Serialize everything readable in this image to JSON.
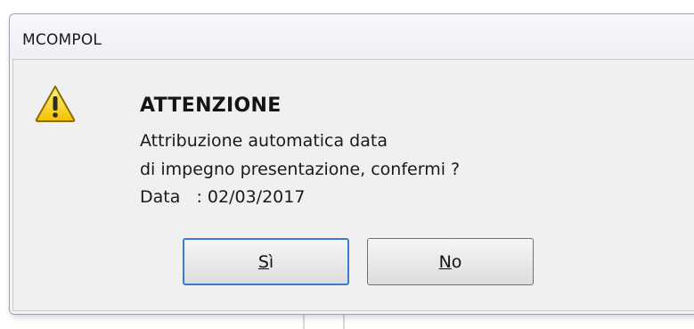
{
  "window": {
    "title": "MCOMPOL"
  },
  "icon": {
    "name": "warning-icon"
  },
  "message": {
    "heading": "ATTENZIONE",
    "line1": "Attribuzione automatica data",
    "line2": "di impegno presentazione, confermi ?",
    "line3": "Data   : 02/03/2017"
  },
  "buttons": {
    "yes": {
      "mnemonic": "S",
      "rest": "ì"
    },
    "no": {
      "mnemonic": "N",
      "rest": "o"
    }
  },
  "colors": {
    "warning_fill": "#f5d21a",
    "warning_stroke": "#8a6d00",
    "focus_border": "#3c7fb1"
  }
}
